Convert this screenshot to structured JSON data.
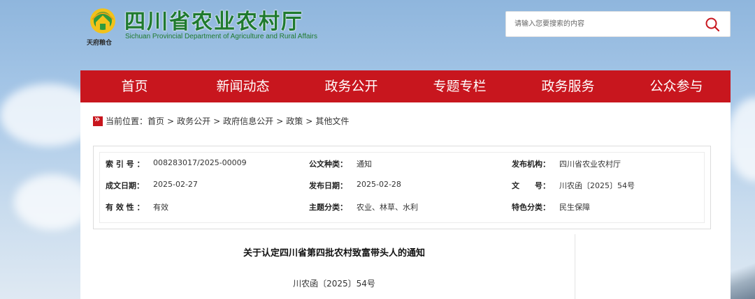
{
  "header": {
    "site_title": "四川省农业农村厅",
    "site_subtitle": "Sichuan Provincial Department of Agriculture and Rural Affairs",
    "slogan": "天府粮仓"
  },
  "search": {
    "placeholder": "请输入您要搜索的内容",
    "value": ""
  },
  "nav": {
    "items": [
      "首页",
      "新闻动态",
      "政务公开",
      "专题专栏",
      "政务服务",
      "公众参与"
    ]
  },
  "breadcrumb": {
    "prefix": "当前位置：",
    "items": [
      "首页",
      "政务公开",
      "政府信息公开",
      "政策",
      "其他文件"
    ],
    "separator": ">"
  },
  "info": {
    "index_label": "索 引 号 ：",
    "index_value": "008283017/2025-00009",
    "doc_type_label": "公文种类：",
    "doc_type_value": "通知",
    "issuer_label": "发布机构：",
    "issuer_value": "四川省农业农村厅",
    "created_label": "成文日期：",
    "created_value": "2025-02-27",
    "published_label": "发布日期：",
    "published_value": "2025-02-28",
    "docno_label": "文　　号：",
    "docno_value": "川农函〔2025〕54号",
    "validity_label": "有 效 性 ：",
    "validity_value": "有效",
    "topic_label": "主题分类：",
    "topic_value": "农业、林草、水利",
    "feature_label": "特色分类：",
    "feature_value": "民生保障"
  },
  "article": {
    "title": "关于认定四川省第四批农村致富带头人的通知",
    "doc_number": "川农函〔2025〕54号"
  },
  "colors": {
    "nav_red": "#c8161e",
    "brand_green": "#1f7a2e"
  }
}
